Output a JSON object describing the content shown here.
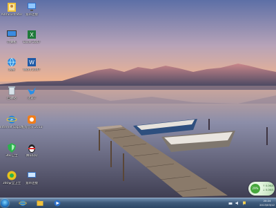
{
  "desktop_icons": [
    {
      "name": "Administrator",
      "label": "Administrator",
      "icon": "user-folder-icon"
    },
    {
      "name": "broadband",
      "label": "宽带连接",
      "icon": "network-connection-icon"
    },
    {
      "name": "computer",
      "label": "计算机",
      "icon": "computer-icon"
    },
    {
      "name": "excel",
      "label": "Excel 2007",
      "icon": "excel-icon"
    },
    {
      "name": "network",
      "label": "网络",
      "icon": "network-globe-icon"
    },
    {
      "name": "word",
      "label": "Word 2007",
      "icon": "word-icon"
    },
    {
      "name": "recycle",
      "label": "回收站",
      "icon": "recycle-bin-icon"
    },
    {
      "name": "xunlei",
      "label": "迅雷7",
      "icon": "bird-icon"
    },
    {
      "name": "ie",
      "label": "Internet Explorer",
      "icon": "internet-explorer-icon"
    },
    {
      "name": "kugou",
      "label": "酷狗音乐 2013",
      "icon": "kugou-music-icon"
    },
    {
      "name": "360safe",
      "label": "360卫士",
      "icon": "shield-icon"
    },
    {
      "name": "qq",
      "label": "腾讯QQ",
      "icon": "qq-penguin-icon"
    },
    {
      "name": "360browser",
      "label": "360安全卫士",
      "icon": "360-browser-icon"
    },
    {
      "name": "tools",
      "label": "宽带连接",
      "icon": "network-tool-icon"
    }
  ],
  "gadget": {
    "circle_text": "29%",
    "up": "↑ 0.0K/S",
    "down": "↓ 0.0K/S"
  },
  "taskbar": {
    "items": [
      "ie-taskbar-icon",
      "explorer-taskbar-icon",
      "media-player-taskbar-icon"
    ],
    "tray_icons": [
      "network-tray-icon",
      "volume-tray-icon",
      "flag-tray-icon"
    ],
    "time": "20:24",
    "date": "2013/03/12"
  },
  "colors": {
    "taskbar": "#3e5a7a",
    "sky_top": "#6a7fb5",
    "sky_bottom": "#f2b28a",
    "water": "#8a8fa8"
  }
}
